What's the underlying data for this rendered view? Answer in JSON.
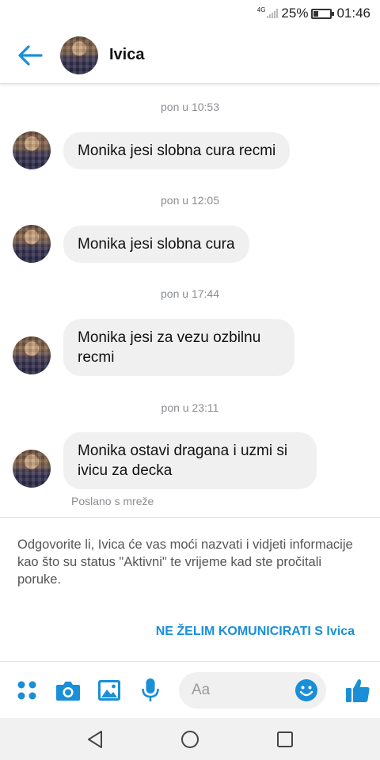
{
  "status_bar": {
    "network": "4G",
    "battery": "25%",
    "time": "01:46"
  },
  "header": {
    "contact_name": "Ivica"
  },
  "conversation": [
    {
      "time": "pon u 10:53",
      "message": "Monika jesi slobna cura recmi"
    },
    {
      "time": "pon u 12:05",
      "message": "Monika jesi slobna cura"
    },
    {
      "time": "pon u 17:44",
      "message": "Monika jesi za vezu ozbilnu recmi"
    },
    {
      "time": "pon u 23:11",
      "message": "Monika ostavi dragana i uzmi si ivicu za decka"
    }
  ],
  "sent_from": "Poslano s mreže",
  "notice": "Odgovorite li, Ivica će vas moći nazvati i vidjeti informacije kao što su status \"Aktivni\" te vrijeme kad ste pročitali poruke.",
  "block_link": "NE ŽELIM KOMUNICIRATI S Ivica",
  "composer": {
    "placeholder": "Aa",
    "icons": [
      "apps-icon",
      "camera-icon",
      "image-icon",
      "microphone-icon",
      "emoji-icon",
      "thumbs-up-icon"
    ]
  },
  "colors": {
    "accent": "#1a8fd8",
    "bubble": "#f1f0f0",
    "muted_text": "#8a8d91"
  }
}
